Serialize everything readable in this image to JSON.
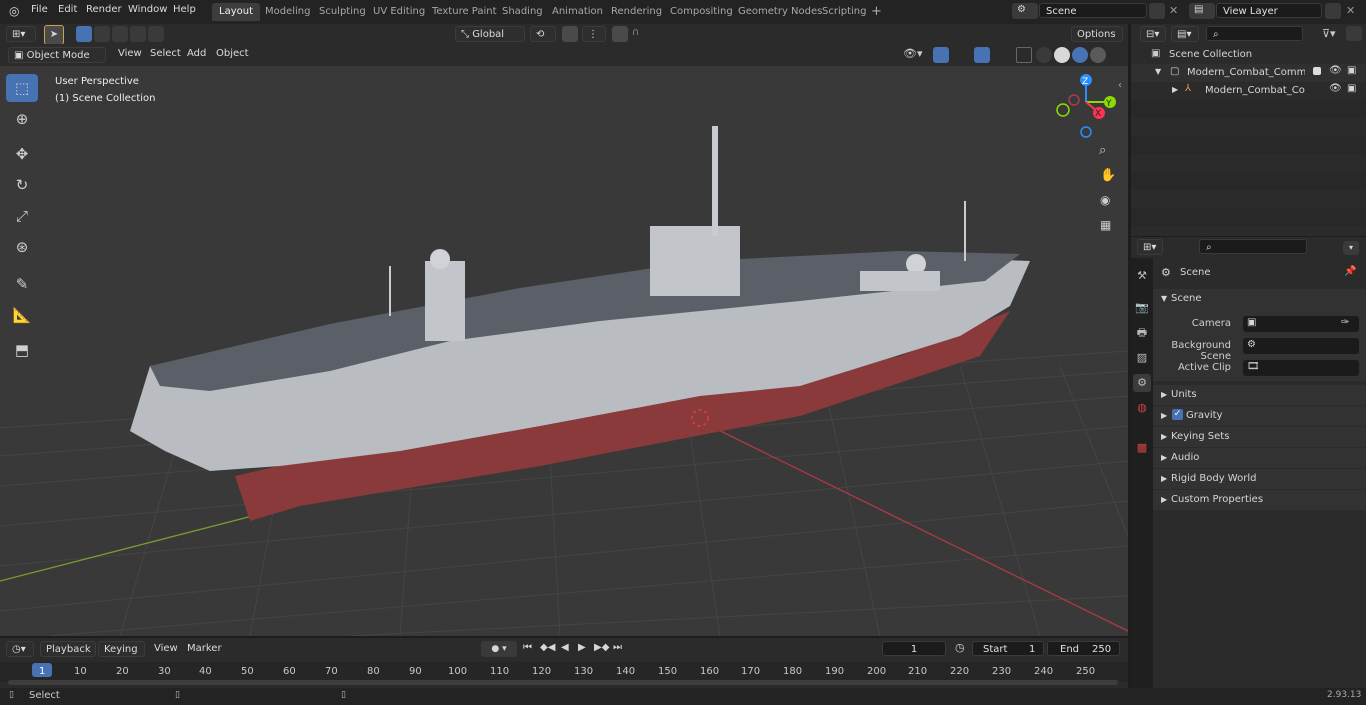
{
  "menu": [
    "File",
    "Edit",
    "Render",
    "Window",
    "Help"
  ],
  "workspaces": [
    "Layout",
    "Modeling",
    "Sculpting",
    "UV Editing",
    "Texture Paint",
    "Shading",
    "Animation",
    "Rendering",
    "Compositing",
    "Geometry Nodes",
    "Scripting"
  ],
  "scene_field": "Scene",
  "view_layer_field": "View Layer",
  "tool_header": {
    "orientation": "Global",
    "options": "Options"
  },
  "viewport_header": {
    "mode": "Object Mode",
    "view": "View",
    "select": "Select",
    "add": "Add",
    "object": "Object"
  },
  "viewport": {
    "perspective": "User Perspective",
    "collection": "(1) Scene Collection"
  },
  "gizmo": {
    "z": "Z",
    "y": "Y",
    "x": "X"
  },
  "outliner": {
    "root": "Scene Collection",
    "items": [
      "Modern_Combat_Command_",
      "Modern_Combat_Comma"
    ]
  },
  "properties": {
    "context_title": "Scene",
    "panel": "Scene",
    "camera_label": "Camera",
    "bg_scene_label": "Background Scene",
    "active_clip_label": "Active Clip",
    "sections": [
      "Units",
      "Gravity",
      "Keying Sets",
      "Audio",
      "Rigid Body World",
      "Custom Properties"
    ]
  },
  "timeline": {
    "playback": "Playback",
    "keying": "Keying",
    "view": "View",
    "marker": "Marker",
    "current_frame": "1",
    "start_label": "Start",
    "start": "1",
    "end_label": "End",
    "end": "250",
    "ruler": [
      "1",
      "10",
      "20",
      "30",
      "40",
      "50",
      "60",
      "70",
      "80",
      "90",
      "100",
      "110",
      "120",
      "130",
      "140",
      "150",
      "160",
      "170",
      "180",
      "190",
      "200",
      "210",
      "220",
      "230",
      "240",
      "250"
    ]
  },
  "status": {
    "select": "Select",
    "version": "2.93.13"
  },
  "colors": {
    "accent": "#4772b3",
    "x_axis": "#ff3352",
    "y_axis": "#8bdc00",
    "z_axis": "#2890ff",
    "hull_red": "#8a3a3a",
    "hull_grey": "#b9bcc1"
  }
}
